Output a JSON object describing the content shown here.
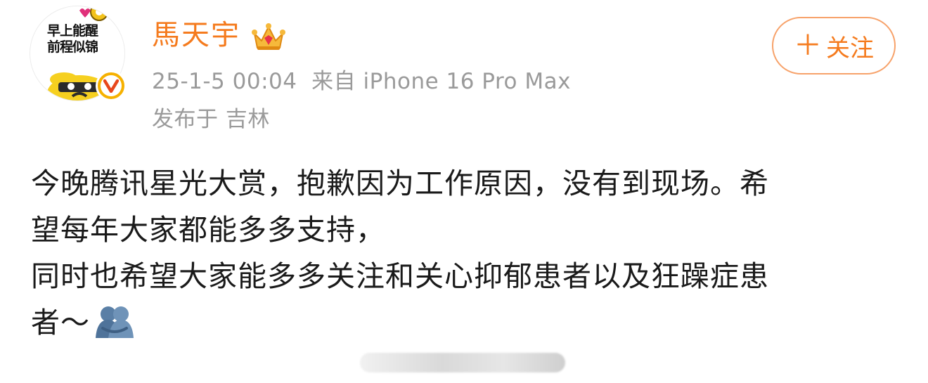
{
  "avatar": {
    "text": "早上能醒\n前程似锦",
    "badge_icon": "verified-v-icon",
    "badge_color": "#f6b100"
  },
  "user": {
    "name": "馬天宇",
    "name_color": "#f57b1e",
    "crown_icon": "crown-icon"
  },
  "meta": {
    "time_source": "25-1-5 00:04  来自 iPhone 16 Pro Max",
    "location": "发布于 吉林",
    "text_color": "#9a9a9a"
  },
  "follow": {
    "plus": "＋",
    "label": "关注",
    "color": "#f57b1e"
  },
  "post": {
    "lines": [
      "今晚腾讯星光大赏，抱歉因为工作原因，没有到现场。希",
      "望每年大家都能多多支持，",
      "同时也希望大家能多多关注和关心抑郁患者以及狂躁症患",
      "者～"
    ],
    "emoji": "hug-icon"
  }
}
